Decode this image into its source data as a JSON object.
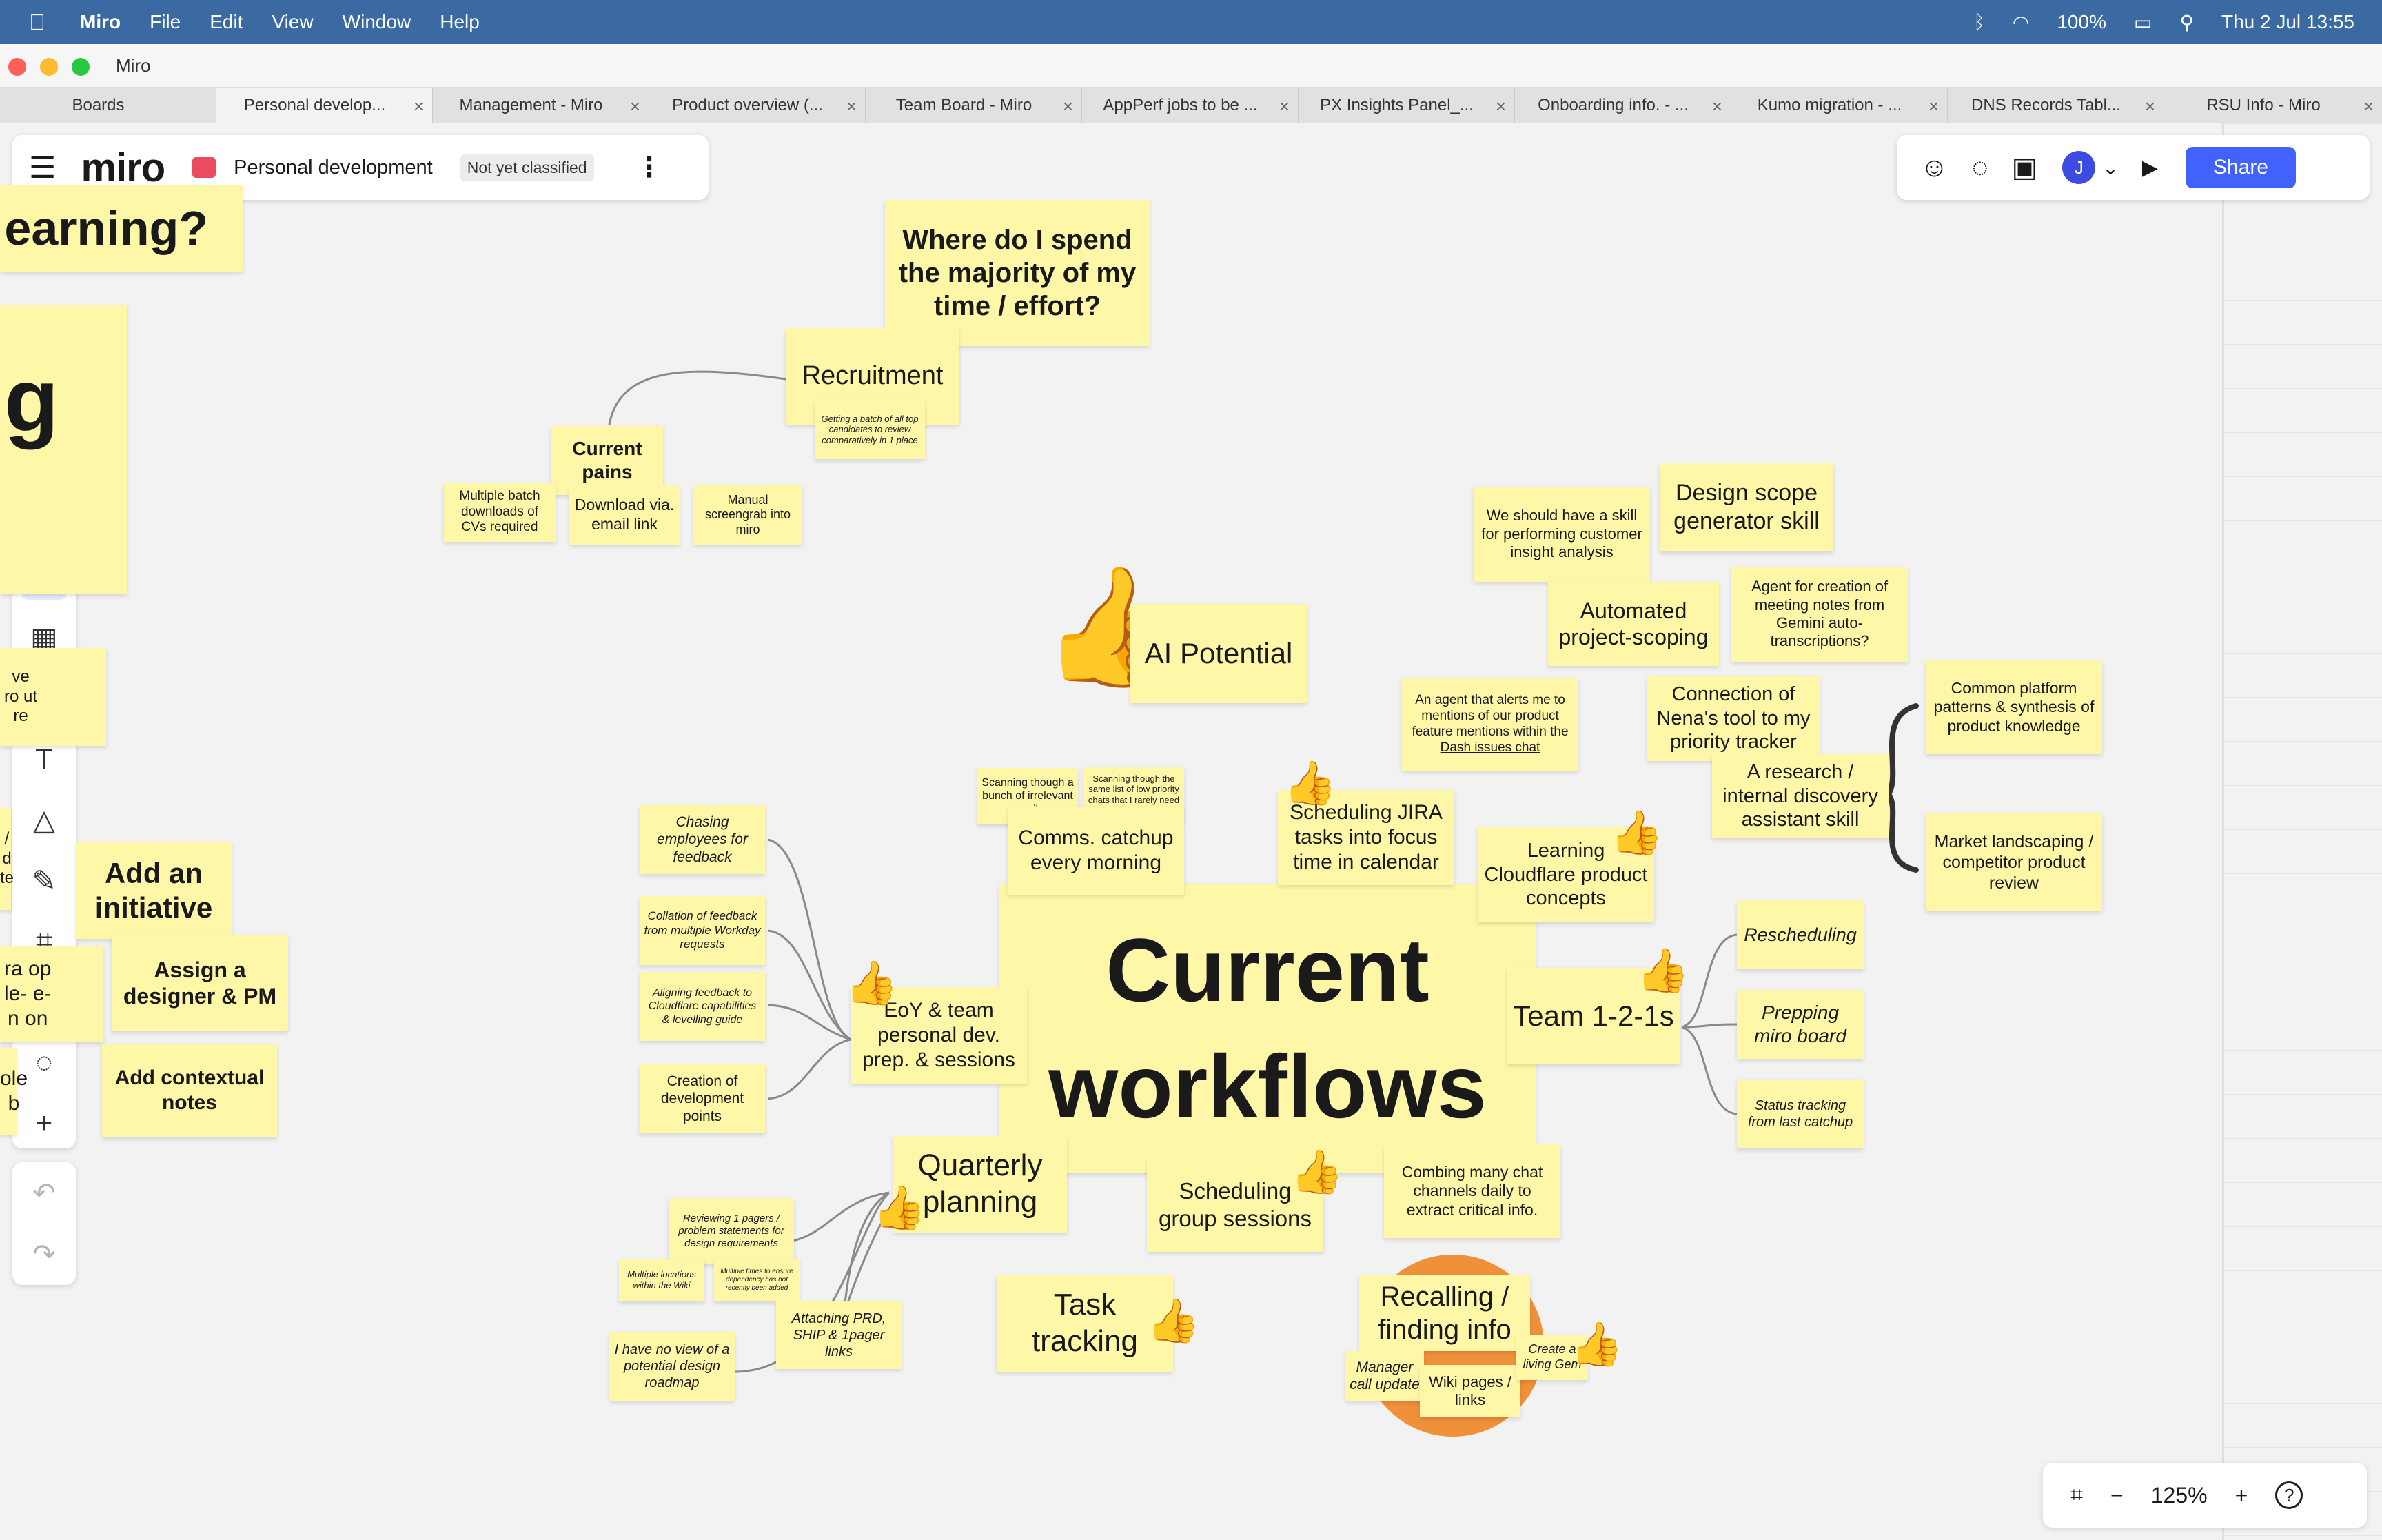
{
  "menubar": {
    "app": "Miro",
    "items": [
      "File",
      "Edit",
      "View",
      "Window",
      "Help"
    ],
    "battery": "100%",
    "datetime": "Thu 2 Jul  13:55"
  },
  "window": {
    "title": "Miro"
  },
  "tabs": [
    {
      "label": "Boards"
    },
    {
      "label": "Personal develop..."
    },
    {
      "label": "Management - Miro"
    },
    {
      "label": "Product overview (..."
    },
    {
      "label": "Team Board - Miro"
    },
    {
      "label": "AppPerf jobs to be ..."
    },
    {
      "label": "PX Insights Panel_..."
    },
    {
      "label": "Onboarding info. - ..."
    },
    {
      "label": "Kumo migration - ..."
    },
    {
      "label": "DNS Records Tabl..."
    },
    {
      "label": "RSU Info - Miro"
    }
  ],
  "header": {
    "logo": "miro",
    "board_name": "Personal development",
    "classification": "Not yet classified"
  },
  "collab": {
    "avatar": "J",
    "share": "Share"
  },
  "zoom": {
    "level": "125%"
  },
  "board": {
    "learning": "earning?",
    "big_g": "g",
    "frag1": "ve\nro ut\nre",
    "frag2": "/\nd\nte",
    "frag3": "ra op\nle- e-\nn on",
    "frag4": "ole\nb",
    "add_initiative": "Add an initiative",
    "assign": "Assign a designer & PM",
    "contextual": "Add contextual notes",
    "where": "Where do I spend the majority of my time / effort?",
    "recruitment": "Recruitment",
    "recruit_sub": "Getting a batch of all top candidates to review comparatively in 1 place",
    "current_pains": "Current pains",
    "multiple_batch": "Multiple batch downloads of CVs required",
    "download_email": "Download via. email link",
    "manual_screengrab": "Manual screengrab into miro",
    "ai_potential": "AI Potential",
    "main": "Current workflows",
    "design_scope": "Design scope generator skill",
    "skill_insight": "We should have a skill for performing customer insight analysis",
    "automated_scoping": "Automated project-scoping",
    "agent_meeting": "Agent for creation of meeting notes from Gemini auto-transcriptions?",
    "agent_alert": "An agent that alerts me to mentions of our product feature mentions within the ",
    "agent_alert_link": "Dash issues chat",
    "nena": "Connection of Nena's tool to my priority tracker",
    "research": "A research / internal discovery assistant skill",
    "common_platform": "Common platform patterns & synthesis of product knowledge",
    "market": "Market landscaping / competitor product review",
    "scan_emails": "Scanning though a bunch of irrelevant emails",
    "scan_chats": "Scanning though the same list of low priority chats that I rarely need to",
    "comms": "Comms. catchup every morning",
    "jira": "Scheduling JIRA tasks into focus time in calendar",
    "learning_cf": "Learning Cloudflare product concepts",
    "chasing": "Chasing employees for feedback",
    "collation": "Collation of feedback from multiple Workday requests",
    "aligning": "Aligning feedback to Cloudflare capabilities & levelling guide",
    "creation_dev": "Creation of development points",
    "eoy": "EoY & team personal dev. prep. & sessions",
    "team": "Team 1-2-1s",
    "rescheduling": "Rescheduling",
    "prepping": "Prepping miro board",
    "status_tracking": "Status tracking from last catchup",
    "quarterly": "Quarterly planning",
    "scheduling_group": "Scheduling group sessions",
    "combing": "Combing many chat channels daily to extract critical info.",
    "reviewing": "Reviewing 1 pagers / problem statements for design requirements",
    "multiple_locations": "Multiple locations within the Wiki",
    "multiple_times": "Multiple times to ensure dependency has not recently been added",
    "attaching": "Attaching PRD, SHIP & 1pager links",
    "no_view": "I have no view of a potential design roadmap",
    "task_tracking": "Task tracking",
    "recalling": "Recalling / finding info",
    "manager": "Manager call update",
    "wiki": "Wiki pages / links",
    "create_a": "Create a living Gem"
  },
  "colors": {
    "sticky": "#fff7a8",
    "accent": "#4262ff",
    "menubar": "#3b6aa3",
    "circle": "#f0913a"
  },
  "icons": {
    "apple": "",
    "menu": "☰",
    "dots": "⋮",
    "sparkle": "✦",
    "cursor": "➤",
    "table": "▦",
    "sticky": "□",
    "text": "T",
    "shapes": "△",
    "pen": "✎",
    "frame": "⌗",
    "emoji": "☺",
    "comment": "◌",
    "plus": "+",
    "undo": "↶",
    "redo": "↷",
    "fit": "⌗",
    "minus": "−",
    "help": "?",
    "thumb": "👍",
    "chat": "◌",
    "video": "▣",
    "play": "▶",
    "chevron": "⌄",
    "wifi": "◠",
    "search": "⚲",
    "bluetooth": "ᛒ",
    "battery": "▭",
    "share_icon": "☺"
  }
}
